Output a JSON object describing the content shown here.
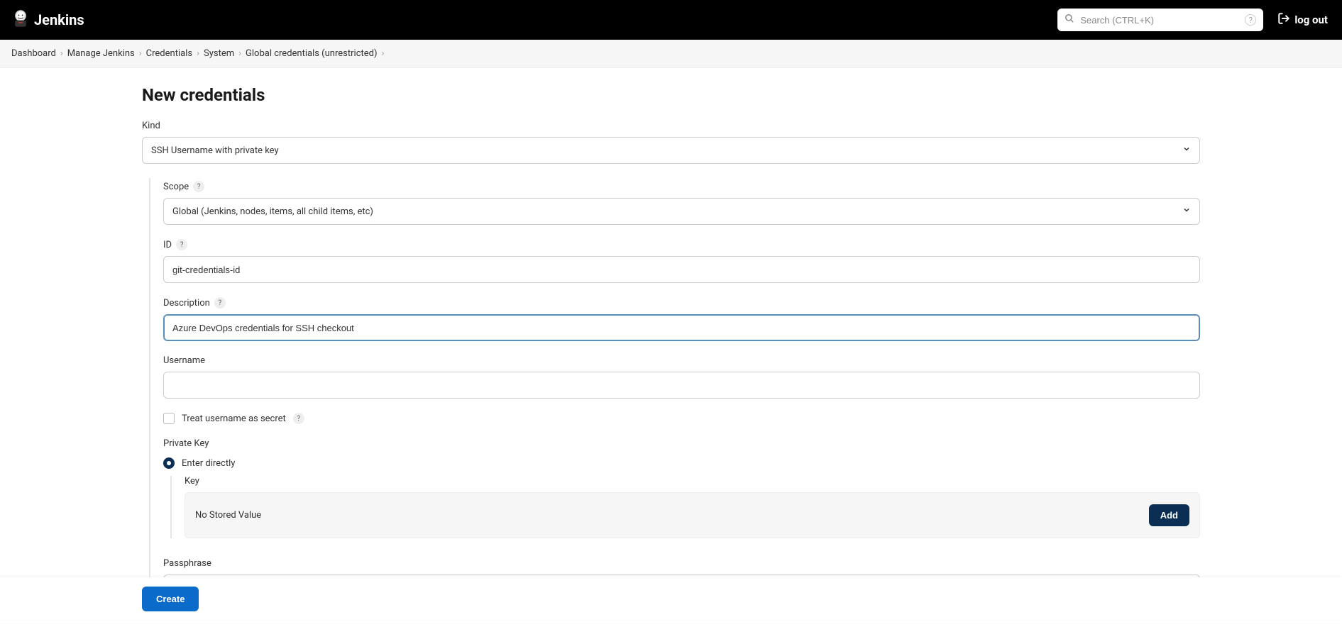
{
  "header": {
    "title": "Jenkins",
    "search_placeholder": "Search (CTRL+K)",
    "logout_label": "log out"
  },
  "breadcrumb": {
    "items": [
      "Dashboard",
      "Manage Jenkins",
      "Credentials",
      "System",
      "Global credentials (unrestricted)"
    ]
  },
  "page": {
    "title": "New credentials"
  },
  "form": {
    "kind_label": "Kind",
    "kind_value": "SSH Username with private key",
    "scope_label": "Scope",
    "scope_value": "Global (Jenkins, nodes, items, all child items, etc)",
    "id_label": "ID",
    "id_value": "git-credentials-id",
    "description_label": "Description",
    "description_value": "Azure DevOps credentials for SSH checkout",
    "username_label": "Username",
    "username_value": "",
    "treat_secret_label": "Treat username as secret",
    "private_key_label": "Private Key",
    "enter_directly_label": "Enter directly",
    "key_label": "Key",
    "no_stored_text": "No Stored Value",
    "add_btn_label": "Add",
    "passphrase_label": "Passphrase",
    "passphrase_value": ""
  },
  "footer": {
    "create_label": "Create"
  }
}
